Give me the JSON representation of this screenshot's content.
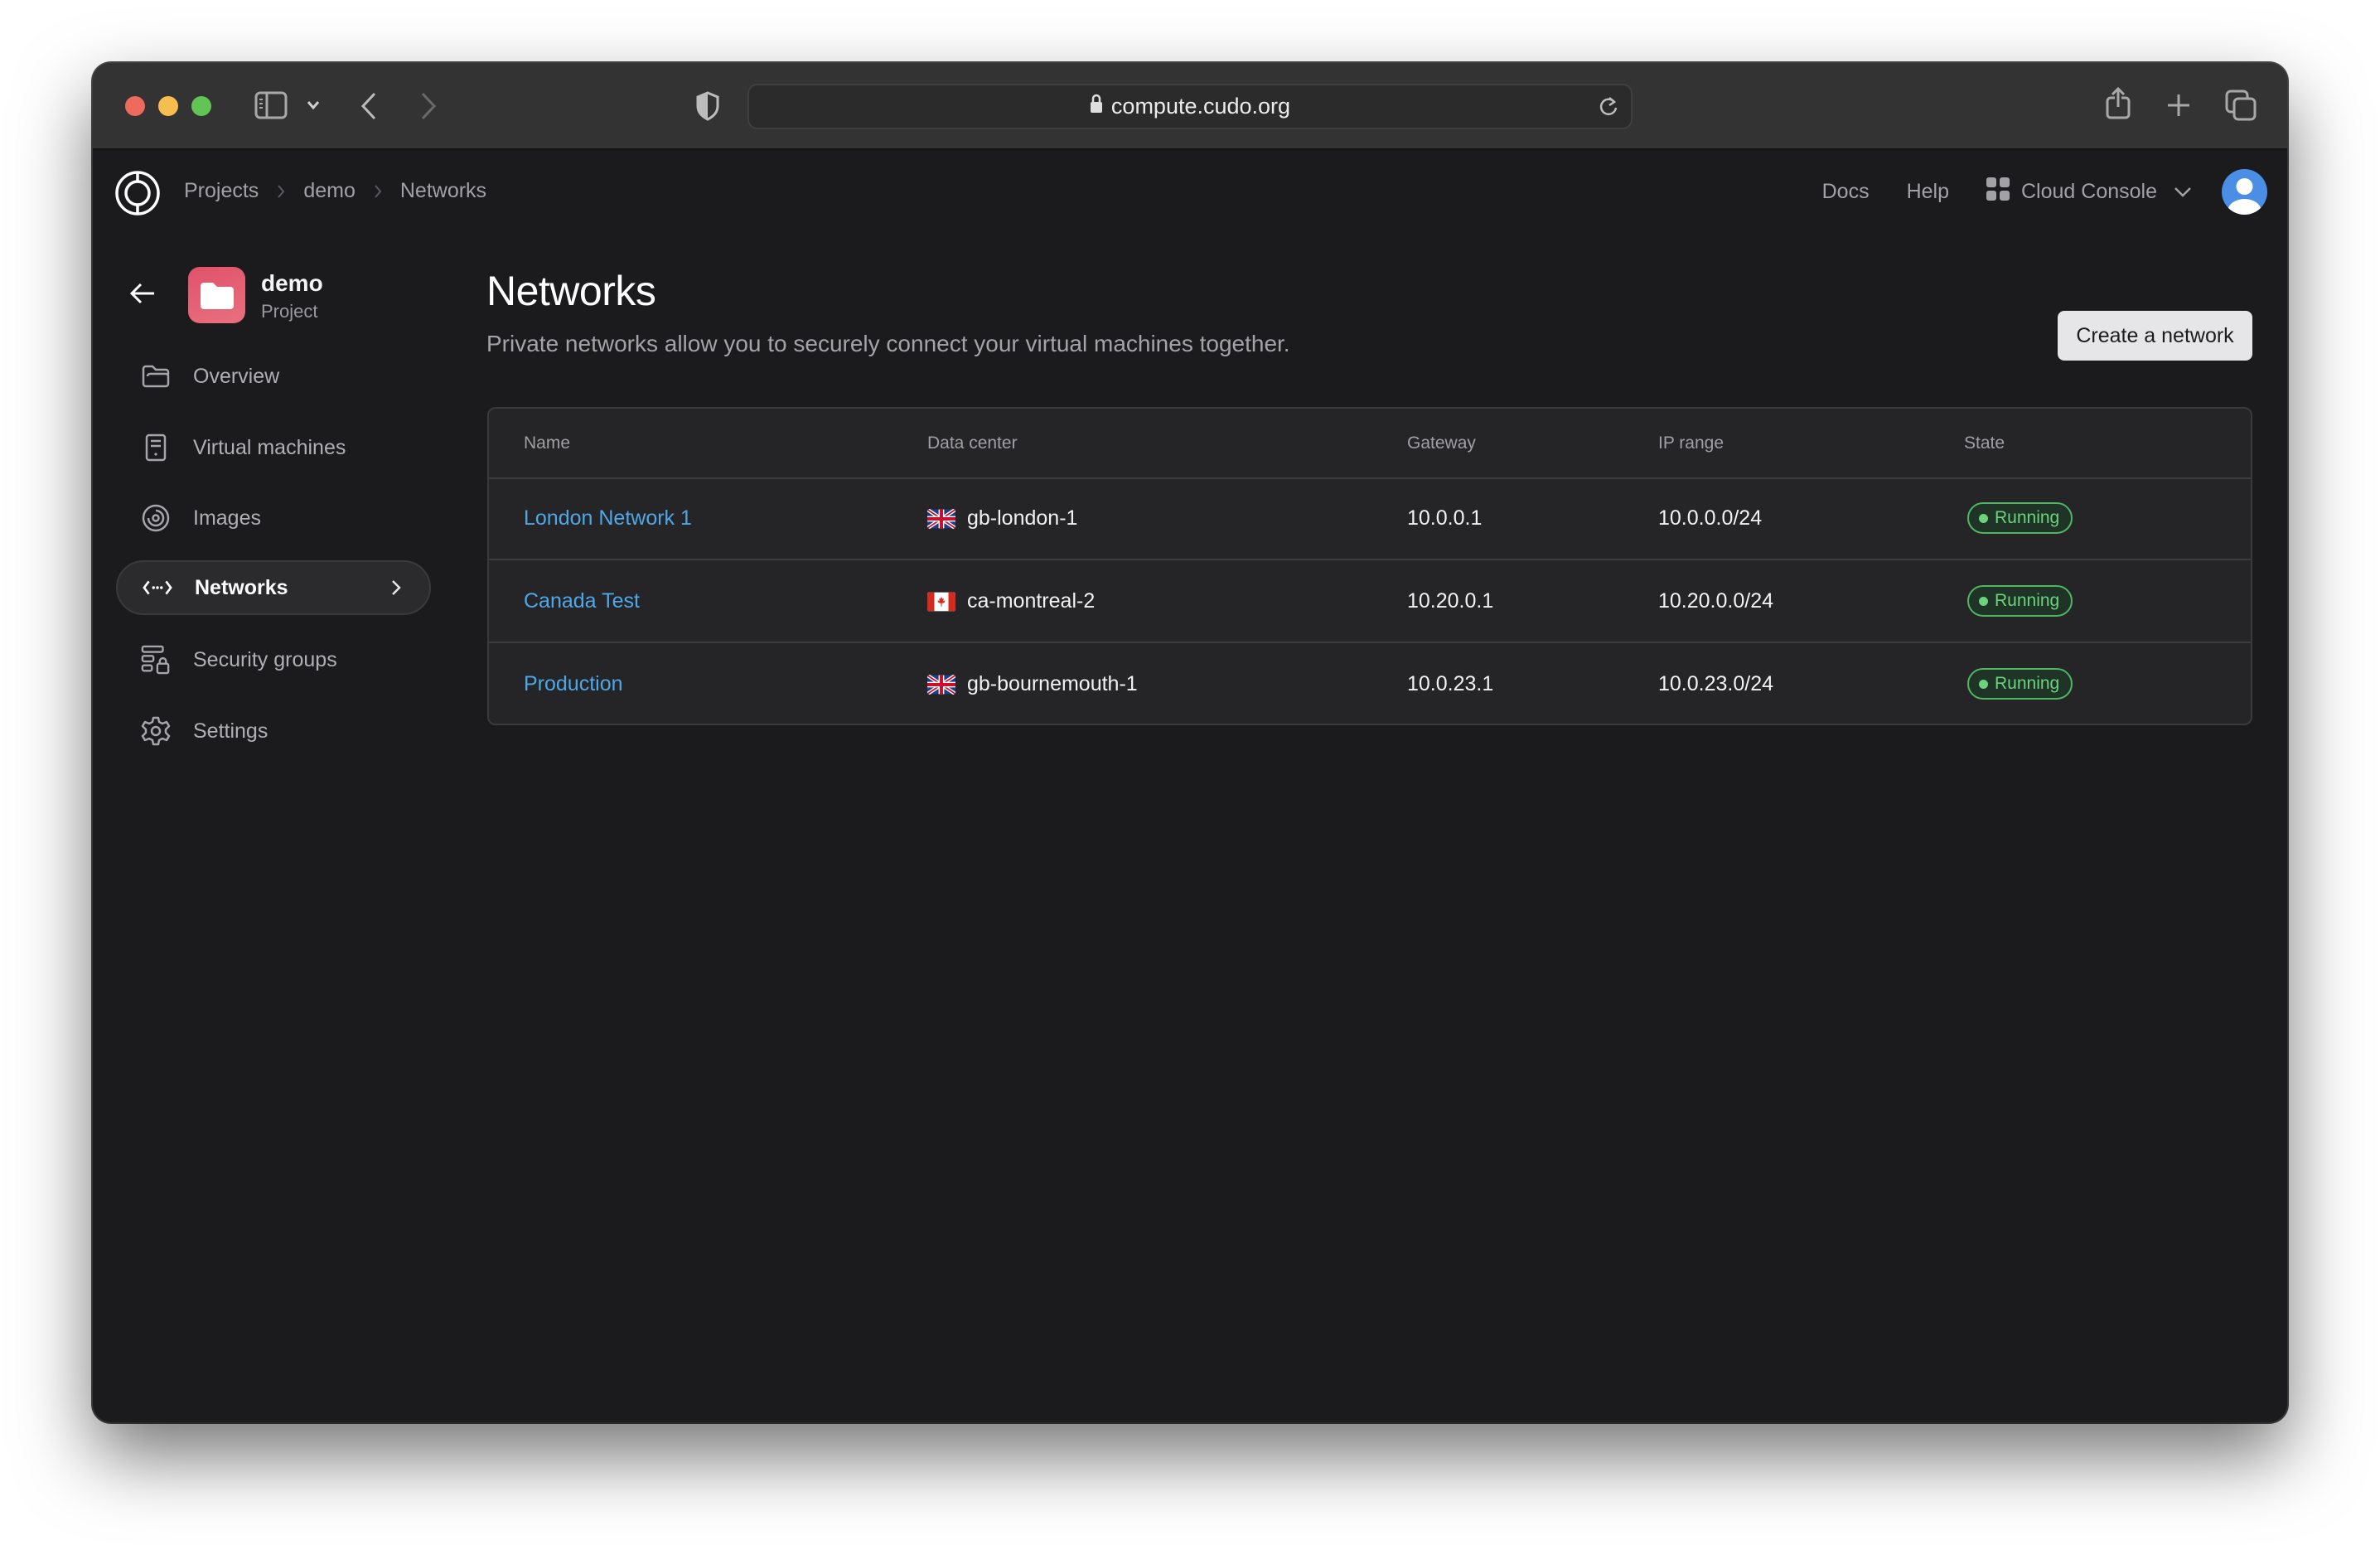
{
  "browser": {
    "url": "compute.cudo.org",
    "icons": {
      "sidebar_toggle": "sidebar-toggle-icon",
      "back": "chevron-left-icon",
      "forward": "chevron-right-icon",
      "privacy": "shield-icon",
      "lock": "lock-icon",
      "reload": "reload-icon",
      "share": "share-icon",
      "new_tab": "plus-icon",
      "tabs": "tabs-overview-icon"
    }
  },
  "header": {
    "breadcrumb": [
      "Projects",
      "demo",
      "Networks"
    ],
    "links": {
      "docs": "Docs",
      "help": "Help"
    },
    "console_label": "Cloud Console"
  },
  "project": {
    "name": "demo",
    "type": "Project"
  },
  "sidebar": {
    "items": [
      {
        "label": "Overview",
        "icon": "folder-icon",
        "active": false
      },
      {
        "label": "Virtual machines",
        "icon": "server-icon",
        "active": false
      },
      {
        "label": "Images",
        "icon": "disc-icon",
        "active": false
      },
      {
        "label": "Networks",
        "icon": "network-icon",
        "active": true
      },
      {
        "label": "Security groups",
        "icon": "security-group-icon",
        "active": false
      },
      {
        "label": "Settings",
        "icon": "gear-icon",
        "active": false
      }
    ]
  },
  "main": {
    "title": "Networks",
    "subtitle": "Private networks allow you to securely connect your virtual machines together.",
    "create_button": "Create a network",
    "table": {
      "columns": [
        "Name",
        "Data center",
        "Gateway",
        "IP range",
        "State"
      ],
      "rows": [
        {
          "name": "London Network 1",
          "flag": "gb",
          "data_center": "gb-london-1",
          "gateway": "10.0.0.1",
          "ip_range": "10.0.0.0/24",
          "state": "Running"
        },
        {
          "name": "Canada Test",
          "flag": "ca",
          "data_center": "ca-montreal-2",
          "gateway": "10.20.0.1",
          "ip_range": "10.20.0.0/24",
          "state": "Running"
        },
        {
          "name": "Production",
          "flag": "gb",
          "data_center": "gb-bournemouth-1",
          "gateway": "10.0.23.1",
          "ip_range": "10.0.23.0/24",
          "state": "Running"
        }
      ]
    }
  },
  "colors": {
    "link": "#4ea8e8",
    "running": "#6ad37c",
    "project_icon": "#e0526a",
    "avatar": "#4a8ee6"
  }
}
